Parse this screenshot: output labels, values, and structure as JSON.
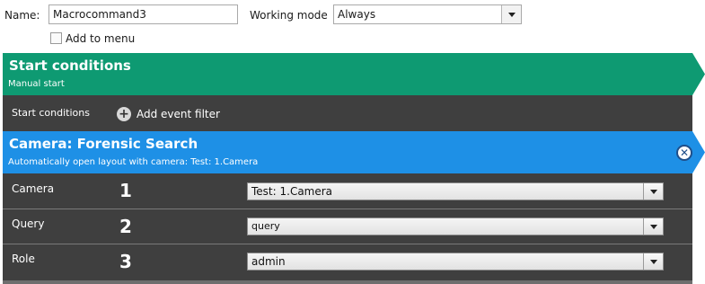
{
  "form": {
    "name_label": "Name:",
    "name_value": "Macrocommand3",
    "working_mode_label": "Working mode",
    "working_mode_value": "Always",
    "add_to_menu_label": "Add to menu",
    "add_to_menu_checked": false
  },
  "start_conditions": {
    "title": "Start conditions",
    "subtitle": "Manual start",
    "row_label": "Start conditions",
    "add_filter_label": "Add event filter"
  },
  "action": {
    "title": "Camera: Forensic Search",
    "subtitle": "Automatically open layout with camera: Test: 1.Camera",
    "rows": [
      {
        "label": "Camera",
        "number": "1",
        "value": "Test: 1.Camera"
      },
      {
        "label": "Query",
        "number": "2",
        "value": "query"
      },
      {
        "label": "Role",
        "number": "3",
        "value": "admin"
      }
    ]
  },
  "colors": {
    "green_banner": "#0e9a72",
    "blue_banner": "#1e90e6",
    "dark_panel": "#3f3f3f"
  }
}
